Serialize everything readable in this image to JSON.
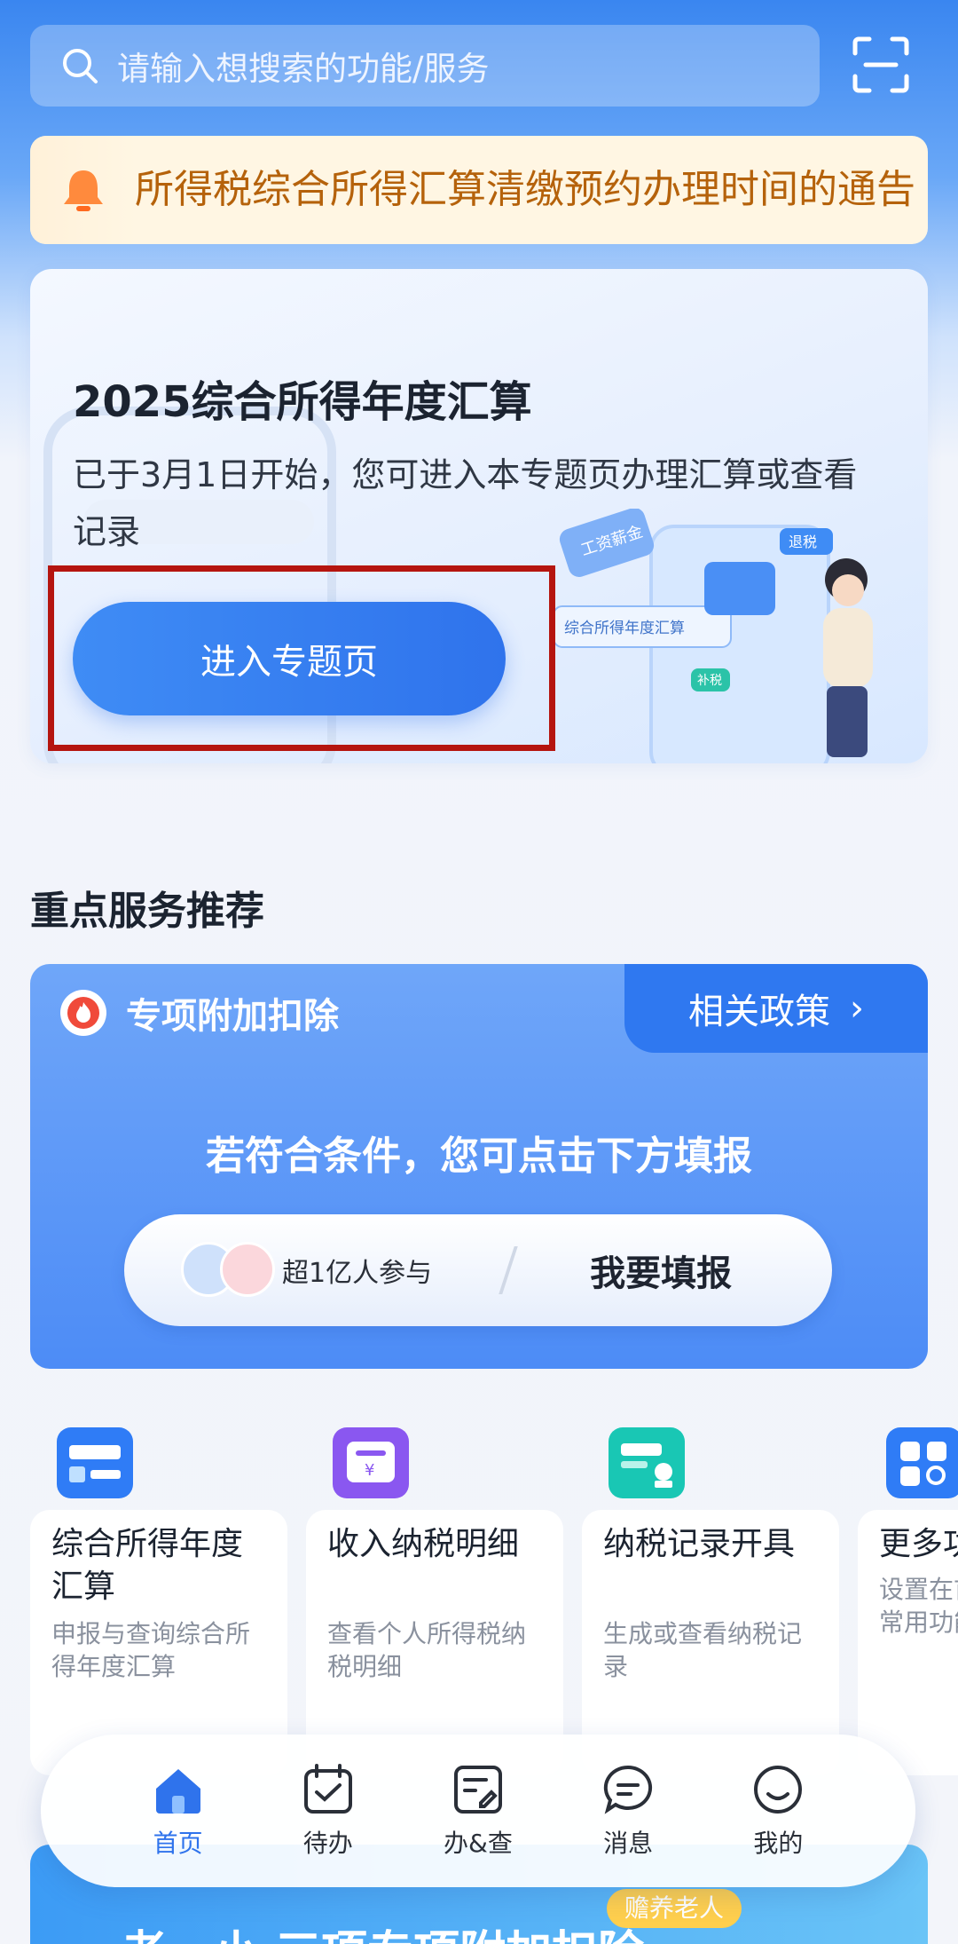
{
  "search": {
    "placeholder": "请输入想搜索的功能/服务"
  },
  "notice": {
    "text": "所得税综合所得汇算清缴预约办理时间的通告"
  },
  "feature": {
    "title": "2025综合所得年度汇算",
    "subtitle": "已于3月1日开始，您可进入本专题页办理汇算或查看记录",
    "button": "进入专题页",
    "illustration_labels": [
      "工资薪金",
      "退税",
      "综合所得年度汇算",
      "补税"
    ]
  },
  "section": {
    "title": "重点服务推荐"
  },
  "deduction": {
    "title": "专项附加扣除",
    "policy_link": "相关政策",
    "hint": "若符合条件，您可点击下方填报",
    "participants": "超1亿人参与",
    "fill_button": "我要填报"
  },
  "services": [
    {
      "name": "综合所得年度汇算",
      "desc": "申报与查询综合所得年度汇算",
      "color": "#2f7cf6"
    },
    {
      "name": "收入纳税明细",
      "desc": "查看个人所得税纳税明细",
      "color": "#8a57f0"
    },
    {
      "name": "纳税记录开具",
      "desc": "生成或查看纳税记录",
      "color": "#19c7b4"
    },
    {
      "name": "更多功能",
      "desc": "设置在首页常用功能",
      "color": "#2f7cf6"
    }
  ],
  "nav": [
    {
      "label": "首页",
      "active": true
    },
    {
      "label": "待办"
    },
    {
      "label": "办&查"
    },
    {
      "label": "消息"
    },
    {
      "label": "我的"
    }
  ],
  "banner": {
    "title": "一老一小 三项专项附加扣除",
    "tag": "赡养老人"
  },
  "colors": {
    "primary": "#2f73ec",
    "notice_text": "#b5620b",
    "highlight": "#b5150f"
  }
}
